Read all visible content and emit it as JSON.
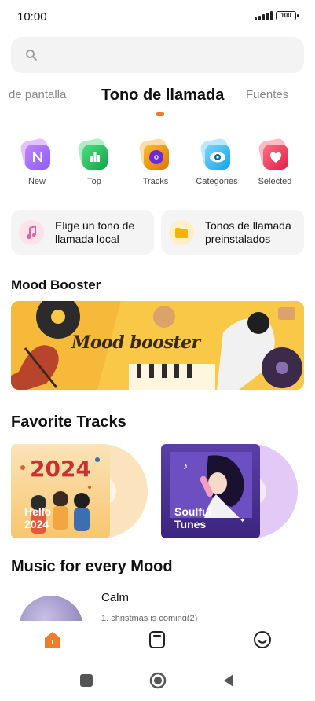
{
  "status": {
    "time": "10:00",
    "battery": "100"
  },
  "search": {
    "icon": "search-icon"
  },
  "tabs": [
    {
      "label": "de pantalla"
    },
    {
      "label": "Tono de llamada"
    },
    {
      "label": "Fuentes"
    }
  ],
  "categories": [
    {
      "label": "New",
      "icon": "new-icon",
      "color": "#a855f7"
    },
    {
      "label": "Top",
      "icon": "chart-icon",
      "color": "#22c55e"
    },
    {
      "label": "Tracks",
      "icon": "vinyl-icon",
      "color": "#8b5cf6"
    },
    {
      "label": "Categories",
      "icon": "eye-icon",
      "color": "#38bdf8"
    },
    {
      "label": "Selected",
      "icon": "heart-icon",
      "color": "#f43f5e"
    }
  ],
  "cards": [
    {
      "line1": "Elige un tono de",
      "line2": "llamada local",
      "icon": "music-note-icon"
    },
    {
      "line1": "Tonos de llamada",
      "line2": "preinstalados",
      "icon": "folder-icon"
    }
  ],
  "sections": {
    "mood_booster": "Mood Booster",
    "favorite_tracks": "Favorite Tracks",
    "music_mood": "Music for every Mood"
  },
  "banner": {
    "title": "Mood booster"
  },
  "tracks": [
    {
      "big": "2024",
      "line1": "Hello",
      "line2": "2024"
    },
    {
      "line1": "Soulful",
      "line2": "Tunes"
    }
  ],
  "mood_item": {
    "name": "Calm",
    "subtitle": "1. christmas is coming(2)"
  },
  "nav": {
    "home": "home-icon",
    "bookmark": "bookmark-icon",
    "profile": "smiley-icon"
  }
}
